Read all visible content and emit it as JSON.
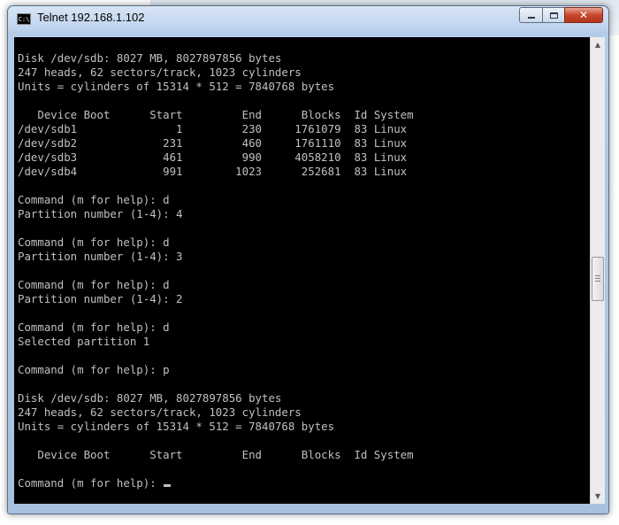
{
  "window": {
    "title": "Telnet 192.168.1.102",
    "icon_label": "C:\\",
    "buttons": {
      "minimize": "minimize-icon",
      "maximize": "maximize-icon",
      "close": "✕"
    }
  },
  "console": {
    "lines": [
      "",
      "Disk /dev/sdb: 8027 MB, 8027897856 bytes",
      "247 heads, 62 sectors/track, 1023 cylinders",
      "Units = cylinders of 15314 * 512 = 7840768 bytes",
      "",
      "   Device Boot      Start         End      Blocks  Id System",
      "/dev/sdb1               1         230     1761079  83 Linux",
      "/dev/sdb2             231         460     1761110  83 Linux",
      "/dev/sdb3             461         990     4058210  83 Linux",
      "/dev/sdb4             991        1023      252681  83 Linux",
      "",
      "Command (m for help): d",
      "Partition number (1-4): 4",
      "",
      "Command (m for help): d",
      "Partition number (1-4): 3",
      "",
      "Command (m for help): d",
      "Partition number (1-4): 2",
      "",
      "Command (m for help): d",
      "Selected partition 1",
      "",
      "Command (m for help): p",
      "",
      "Disk /dev/sdb: 8027 MB, 8027897856 bytes",
      "247 heads, 62 sectors/track, 1023 cylinders",
      "Units = cylinders of 15314 * 512 = 7840768 bytes",
      "",
      "   Device Boot      Start         End      Blocks  Id System",
      ""
    ],
    "prompt": "Command (m for help): "
  },
  "colors": {
    "console_bg": "#000000",
    "console_fg": "#c0c0c0",
    "close_button": "#c7462c"
  }
}
